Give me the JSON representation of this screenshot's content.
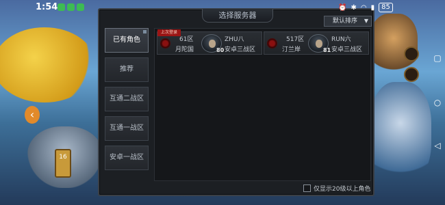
{
  "status_bar": {
    "time": "1:54",
    "battery": "85"
  },
  "dialog": {
    "title": "选择服务器",
    "sort_label": "默认排序",
    "tabs": [
      {
        "label": "已有角色",
        "active": true
      },
      {
        "label": "推荐",
        "active": false
      },
      {
        "label": "互通二战区",
        "active": false
      },
      {
        "label": "互通一战区",
        "active": false
      },
      {
        "label": "安卓一战区",
        "active": false
      }
    ],
    "servers": [
      {
        "recent_tag": "上次登录",
        "zone": "61区",
        "server_name": "月陀国",
        "level": "80",
        "role_name": "ZHU八",
        "region": "安卓三战区"
      },
      {
        "recent_tag": "",
        "zone": "517区",
        "server_name": "汀兰岸",
        "level": "81",
        "role_name": "RUN六",
        "region": "安卓三战区"
      }
    ],
    "filter_label": "仅显示20级以上角色"
  },
  "background": {
    "left_card_text": "16"
  }
}
